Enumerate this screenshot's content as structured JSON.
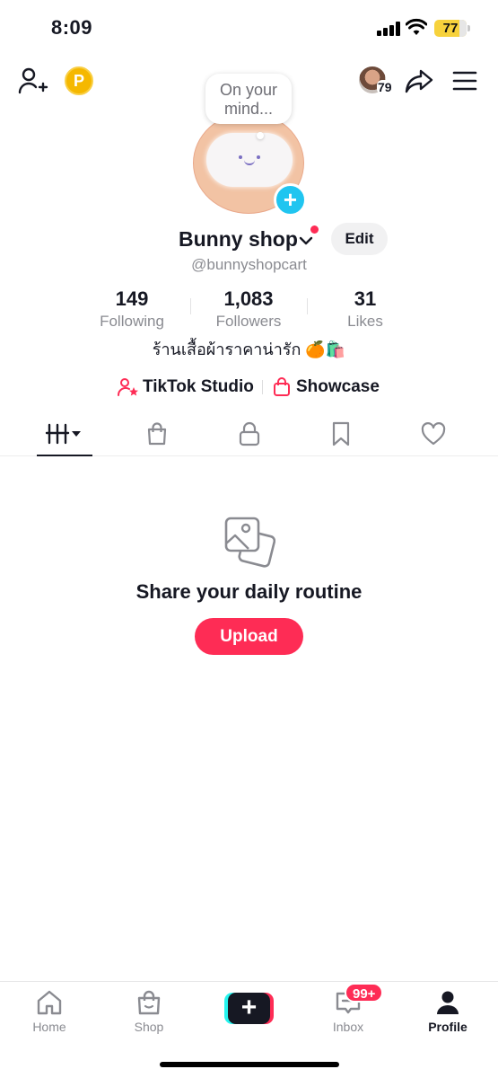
{
  "status_bar": {
    "time": "8:09",
    "battery_percent": 77,
    "battery_text": "77"
  },
  "header": {
    "add_friend_icon": "add-user-icon",
    "coin_label": "P",
    "friends_count": "79",
    "share_icon": "share-arrow-icon",
    "menu_icon": "hamburger-menu-icon"
  },
  "profile": {
    "note_bubble": [
      "On your",
      "mind..."
    ],
    "display_name": "Bunny shop",
    "username": "@bunnyshopcart",
    "edit_label": "Edit",
    "bio": "ร้านเสื้อผ้าราคาน่ารัก 🍊🛍️",
    "stats": [
      {
        "value": "149",
        "label": "Following"
      },
      {
        "value": "1,083",
        "label": "Followers"
      },
      {
        "value": "31",
        "label": "Likes"
      }
    ],
    "links": [
      {
        "label": "TikTok Studio",
        "icon": "studio-user-star-icon",
        "color": "#fe2c55"
      },
      {
        "label": "Showcase",
        "icon": "shopping-bag-icon",
        "color": "#fe2c55"
      }
    ]
  },
  "tabs": [
    {
      "name": "videos",
      "icon": "grid-filter-icon",
      "active": true
    },
    {
      "name": "shop",
      "icon": "shopping-bag-icon",
      "active": false
    },
    {
      "name": "private",
      "icon": "lock-icon",
      "active": false
    },
    {
      "name": "favorites",
      "icon": "bookmark-icon",
      "active": false
    },
    {
      "name": "liked",
      "icon": "heart-icon",
      "active": false
    }
  ],
  "empty_state": {
    "icon": "photos-icon",
    "title": "Share your daily routine",
    "button": "Upload"
  },
  "bottom_nav": {
    "items": [
      {
        "label": "Home",
        "icon": "home-icon",
        "active": false
      },
      {
        "label": "Shop",
        "icon": "shop-bag-icon",
        "active": false
      },
      {
        "label": "",
        "icon": "create-plus-icon",
        "active": false
      },
      {
        "label": "Inbox",
        "icon": "inbox-icon",
        "active": false
      },
      {
        "label": "Profile",
        "icon": "profile-icon",
        "active": true
      }
    ],
    "inbox_badge": "99+"
  },
  "colors": {
    "accent": "#fe2c55",
    "cyan": "#25f4ee",
    "avatar_plus": "#20c5f0",
    "coin": "#f5b800",
    "text": "#161823",
    "muted": "#8a8b91"
  }
}
